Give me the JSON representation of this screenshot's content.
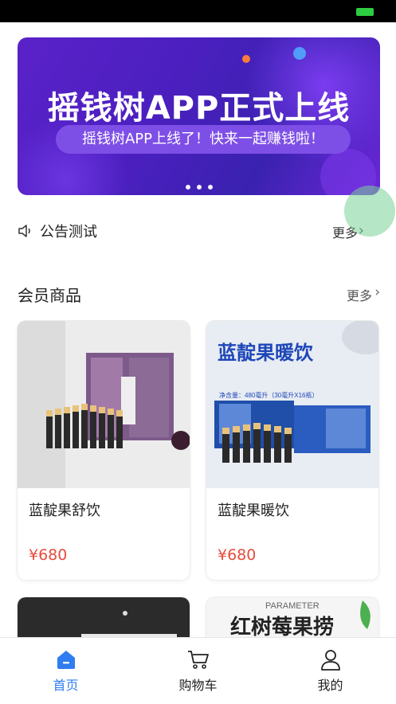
{
  "banner": {
    "title": "摇钱树APP正式上线",
    "subtitle": "摇钱树APP上线了！快来一起赚钱啦！"
  },
  "notice": {
    "text": "公告测试",
    "more": "更多"
  },
  "section": {
    "title": "会员商品",
    "more": "更多"
  },
  "products": [
    {
      "name": "蓝靛果舒饮",
      "price": "¥680"
    },
    {
      "name": "蓝靛果暖饮",
      "price": "¥680",
      "image_text": "蓝靛果暖饮",
      "image_subtext": "净含量：480毫升（30毫升X16瓶）"
    },
    {
      "name": "",
      "price": ""
    },
    {
      "name": "",
      "price": "",
      "image_small": "PARAMETER",
      "image_text": "红树莓果捞"
    }
  ],
  "tabs": [
    {
      "label": "首页",
      "icon": "home-icon",
      "active": true
    },
    {
      "label": "购物车",
      "icon": "cart-icon",
      "active": false
    },
    {
      "label": "我的",
      "icon": "user-icon",
      "active": false
    }
  ],
  "colors": {
    "accent": "#2f7df0",
    "price": "#e74c3c",
    "banner": "#4b1fbf"
  }
}
